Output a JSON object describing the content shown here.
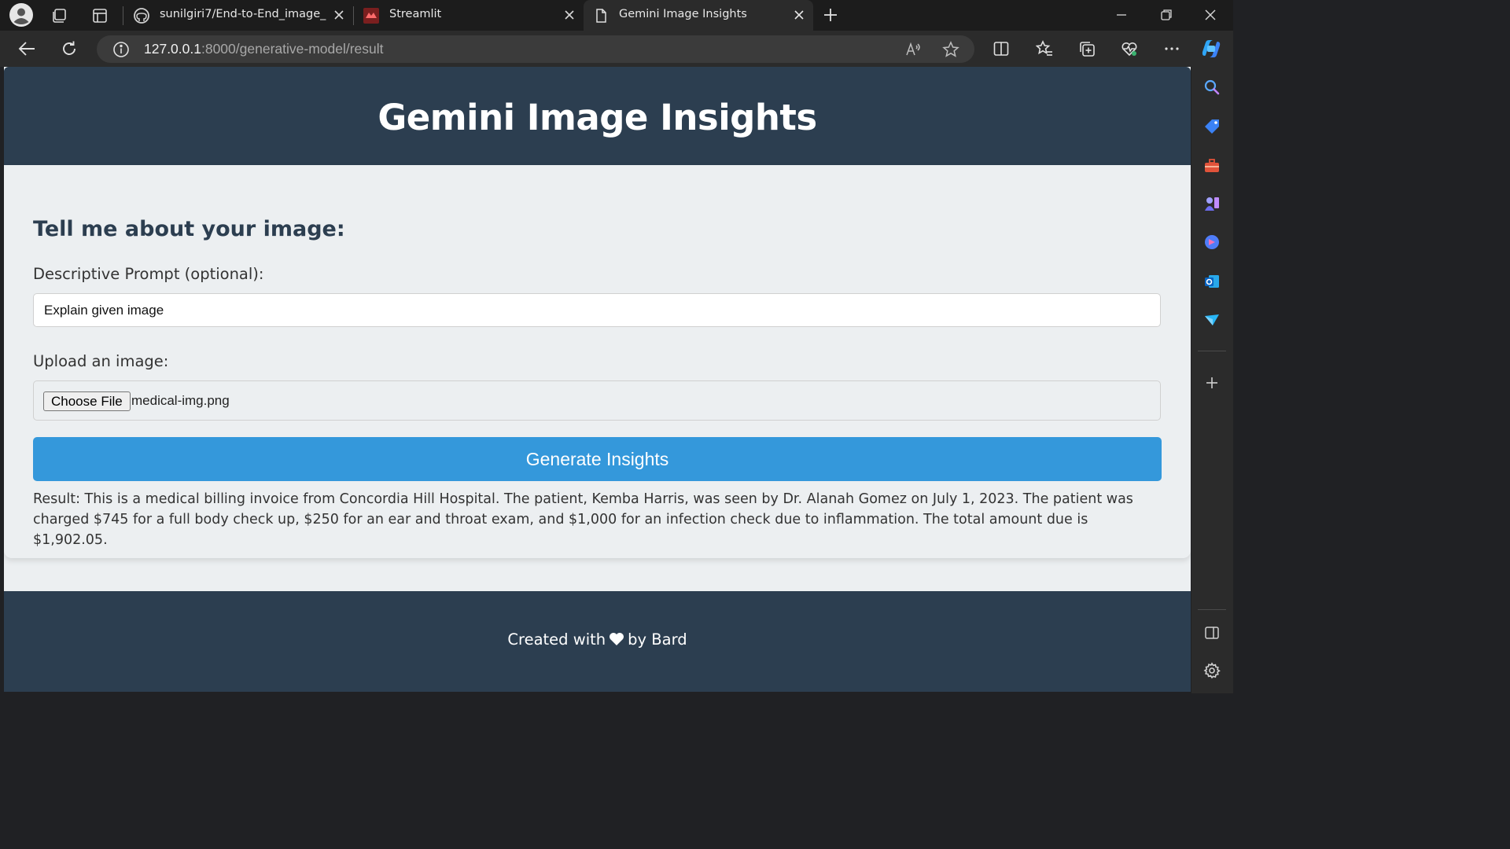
{
  "browser": {
    "tabs": [
      {
        "title": "sunilgiri7/End-to-End_image_scr",
        "icon": "github-icon",
        "active": false
      },
      {
        "title": "Streamlit",
        "icon": "streamlit-icon",
        "active": false
      },
      {
        "title": "Gemini Image Insights",
        "icon": "page-icon",
        "active": true
      }
    ],
    "address": {
      "host": "127.0.0.1",
      "path": ":8000/generative-model/result"
    },
    "sidebar_icons": [
      "search-icon",
      "shopping-tag-icon",
      "toolbox-icon",
      "games-icon",
      "copilot-icon",
      "outlook-icon",
      "send-icon",
      "add-icon",
      "sidebar-toggle-icon",
      "settings-icon"
    ]
  },
  "page": {
    "header_title": "Gemini Image Insights",
    "form": {
      "heading": "Tell me about your image:",
      "prompt_label": "Descriptive Prompt (optional):",
      "prompt_value": "Explain given image",
      "upload_label": "Upload an image:",
      "choose_file_label": "Choose File",
      "file_name": "medical-img.png",
      "submit_label": "Generate Insights"
    },
    "result": "Result: This is a medical billing invoice from Concordia Hill Hospital. The patient, Kemba Harris, was seen by Dr. Alanah Gomez on July 1, 2023. The patient was charged $745 for a full body check up, $250 for an ear and throat exam, and $1,000 for an infection check due to inflammation. The total amount due is $1,902.05.",
    "footer": {
      "prefix": "Created with",
      "suffix": "by Bard",
      "heart_color": "#ffffff"
    },
    "colors": {
      "header_bg": "#2c3e50",
      "accent": "#3498db",
      "page_bg": "#eceff1"
    }
  }
}
